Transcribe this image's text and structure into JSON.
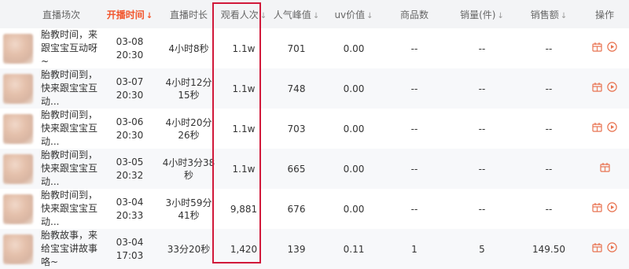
{
  "colors": {
    "accent": "#f2552c",
    "highlight_border": "#d1193a",
    "header_bg": "#f3f4f6"
  },
  "headers": {
    "title": "直播场次",
    "start_time": "开播时间",
    "duration": "直播时长",
    "views": "观看人次",
    "peak": "人气峰值",
    "uv_value": "uv价值",
    "goods_count": "商品数",
    "sales_count": "销量(件)",
    "sales_amount": "销售额",
    "actions": "操作"
  },
  "sort_icon": "↓",
  "rows": [
    {
      "title": "胎教时间，来跟宝宝互动呀~",
      "date": "03-08",
      "time": "20:30",
      "duration": "4小时8秒",
      "views": "1.1w",
      "peak": "701",
      "uv": "0.00",
      "goods": "--",
      "sales": "--",
      "amount": "--",
      "show_replay": true
    },
    {
      "title": "胎教时间到，快来跟宝宝互动...",
      "date": "03-07",
      "time": "20:30",
      "duration": "4小时12分15秒",
      "views": "1.1w",
      "peak": "748",
      "uv": "0.00",
      "goods": "--",
      "sales": "--",
      "amount": "--",
      "show_replay": true
    },
    {
      "title": "胎教时间到，快来跟宝宝互动...",
      "date": "03-06",
      "time": "20:30",
      "duration": "4小时20分26秒",
      "views": "1.1w",
      "peak": "703",
      "uv": "0.00",
      "goods": "--",
      "sales": "--",
      "amount": "--",
      "show_replay": true
    },
    {
      "title": "胎教时间到，快来跟宝宝互动...",
      "date": "03-05",
      "time": "20:32",
      "duration": "4小时3分38秒",
      "views": "1.1w",
      "peak": "665",
      "uv": "0.00",
      "goods": "--",
      "sales": "--",
      "amount": "--",
      "show_replay": false
    },
    {
      "title": "胎教时间到，快来跟宝宝互动...",
      "date": "03-04",
      "time": "20:33",
      "duration": "3小时59分41秒",
      "views": "9,881",
      "peak": "676",
      "uv": "0.00",
      "goods": "--",
      "sales": "--",
      "amount": "--",
      "show_replay": true
    },
    {
      "title": "胎教故事，来给宝宝讲故事咯~",
      "date": "03-04",
      "time": "17:03",
      "duration": "33分20秒",
      "views": "1,420",
      "peak": "139",
      "uv": "0.11",
      "goods": "1",
      "sales": "5",
      "amount": "149.50",
      "show_replay": true
    }
  ]
}
